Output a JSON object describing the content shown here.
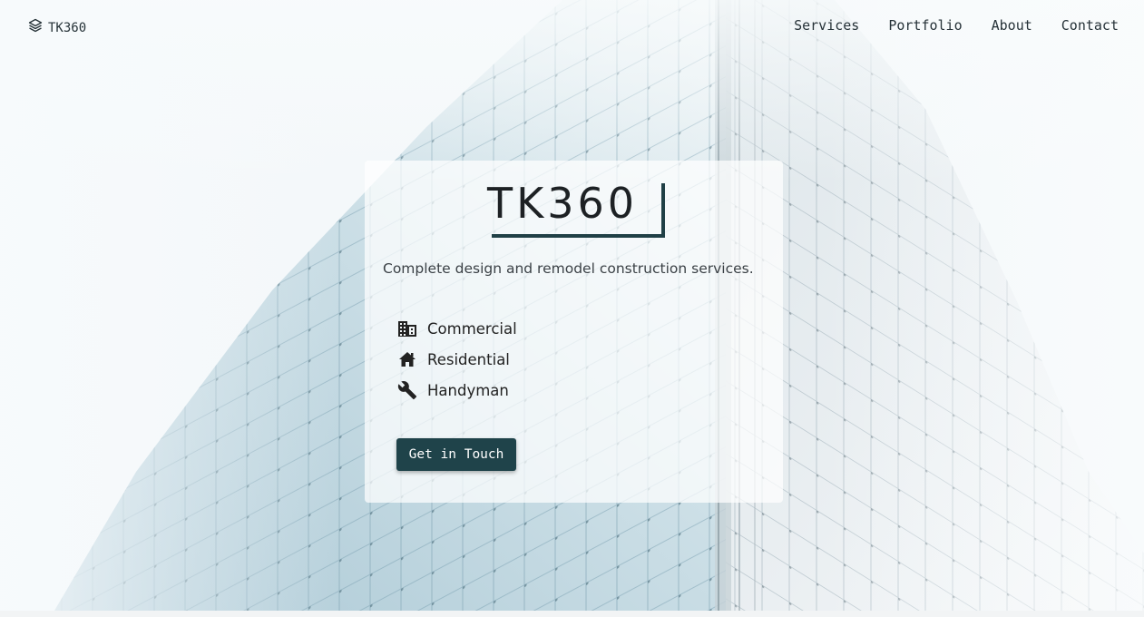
{
  "nav": {
    "brand": "TK360",
    "brand_icon": "layers-icon",
    "links": [
      "Services",
      "Portfolio",
      "About",
      "Contact"
    ]
  },
  "hero": {
    "title": "TK360",
    "tagline": "Complete design and remodel construction services.",
    "services": [
      {
        "label": "Commercial",
        "icon": "building-icon"
      },
      {
        "label": "Residential",
        "icon": "home-icon"
      },
      {
        "label": "Handyman",
        "icon": "wrench-icon"
      }
    ],
    "cta_label": "Get in Touch"
  },
  "colors": {
    "accent": "#1f434a",
    "text": "#263238",
    "background": "#f4f8fa",
    "glass": "#b9d3de"
  }
}
